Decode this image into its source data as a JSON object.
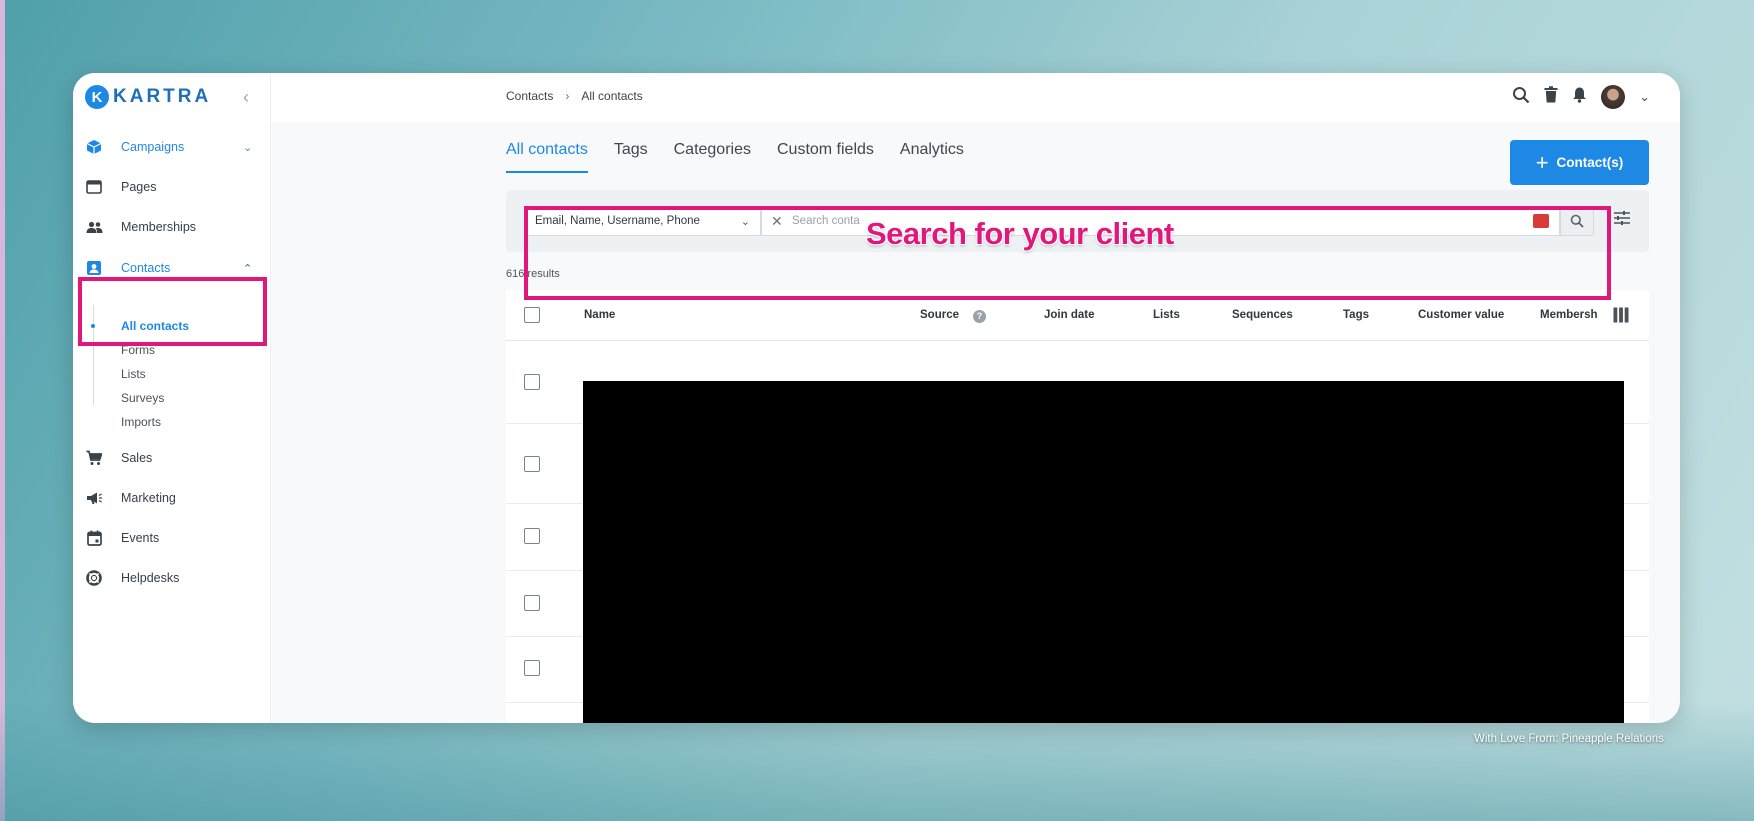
{
  "app": {
    "logo_text": "KARTRA",
    "logo_initial": "K"
  },
  "sidebar": {
    "items": [
      {
        "label": "Campaigns",
        "icon": "cube-icon"
      },
      {
        "label": "Pages",
        "icon": "browser-icon"
      },
      {
        "label": "Memberships",
        "icon": "people-icon"
      },
      {
        "label": "Contacts",
        "icon": "contact-card-icon"
      },
      {
        "label": "Sales",
        "icon": "cart-icon"
      },
      {
        "label": "Marketing",
        "icon": "megaphone-icon"
      },
      {
        "label": "Events",
        "icon": "calendar-icon"
      },
      {
        "label": "Helpdesks",
        "icon": "lifebuoy-icon"
      }
    ],
    "contacts_sub": [
      "All contacts",
      "Forms",
      "Lists",
      "Surveys",
      "Imports"
    ]
  },
  "breadcrumb": {
    "root": "Contacts",
    "current": "All contacts"
  },
  "tabs": [
    "All contacts",
    "Tags",
    "Categories",
    "Custom fields",
    "Analytics"
  ],
  "add_button_label": "Contact(s)",
  "search": {
    "field_select": "Email, Name, Username, Phone",
    "placeholder": "Search conta"
  },
  "results_text": "616 results",
  "table": {
    "columns": [
      "Name",
      "Source",
      "Join date",
      "Lists",
      "Sequences",
      "Tags",
      "Customer value",
      "Membersh"
    ]
  },
  "annotation": "Search for your client",
  "credit": "With Love From: Pineapple Relations",
  "colors": {
    "accent": "#1e88e5",
    "highlight": "#e0187c"
  }
}
